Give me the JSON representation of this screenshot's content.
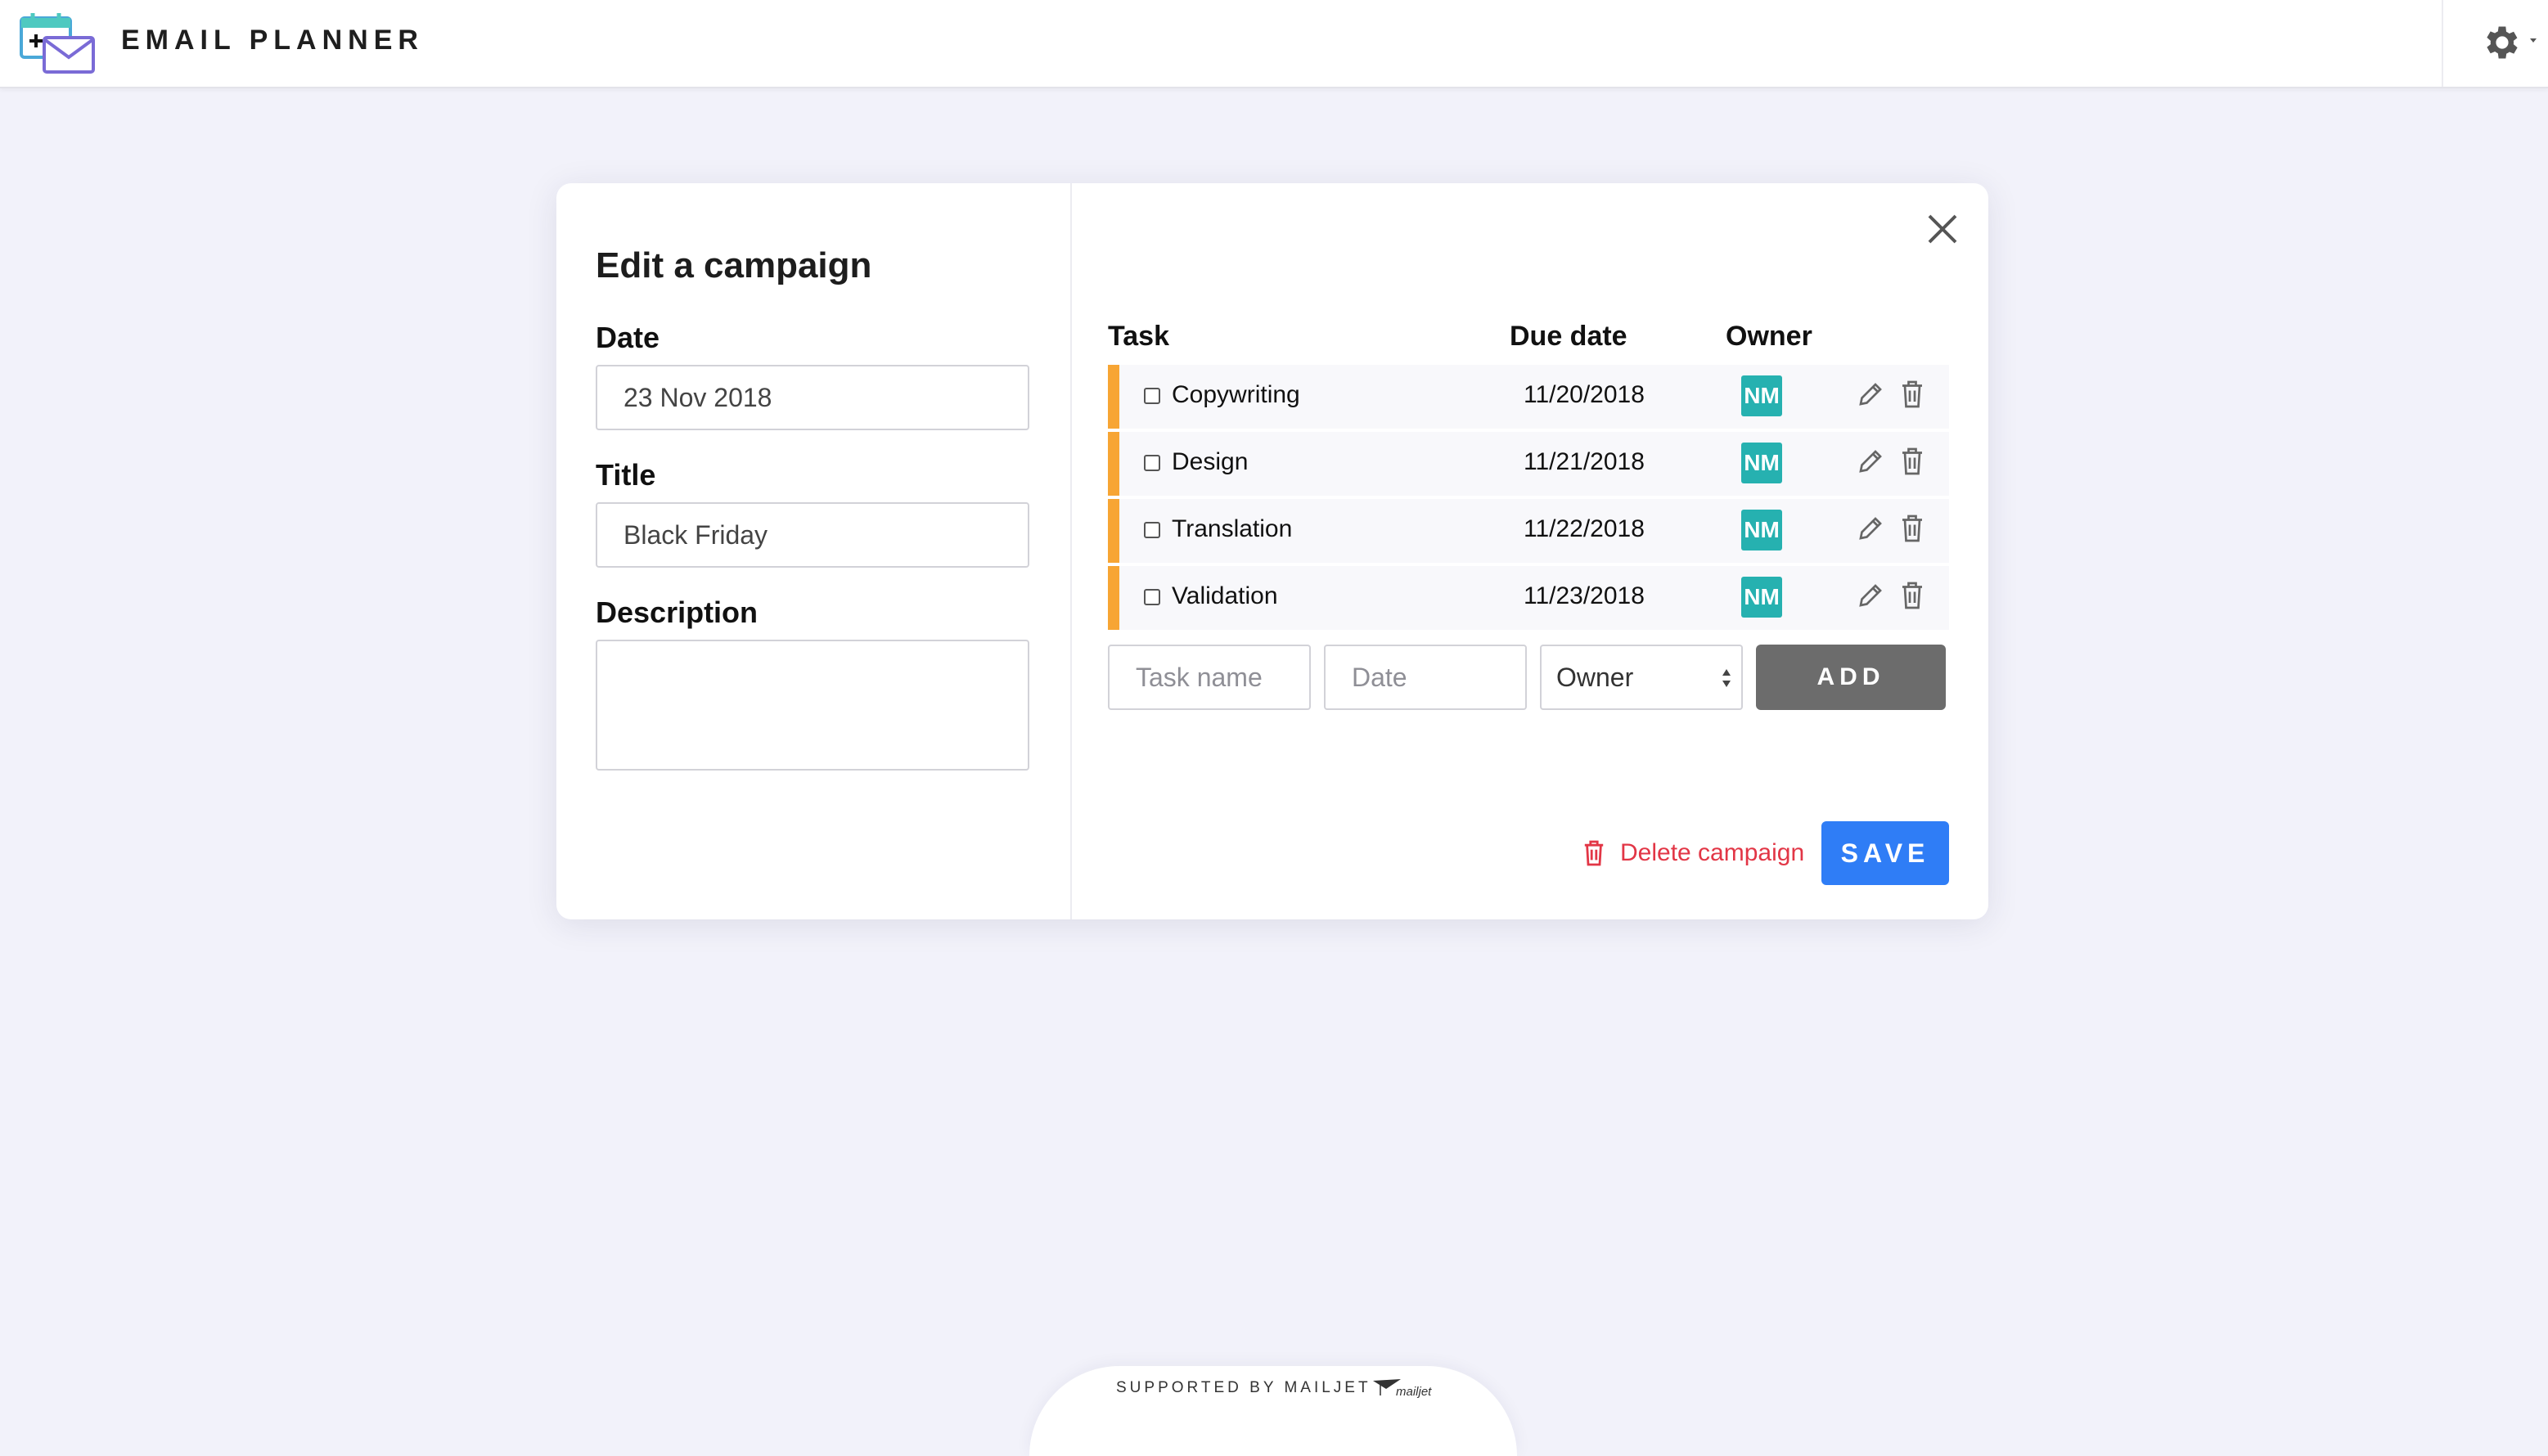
{
  "app": {
    "title": "EMAIL PLANNER"
  },
  "modal": {
    "title": "Edit a campaign",
    "date_label": "Date",
    "date_value": "23 Nov 2018",
    "title_label": "Title",
    "title_value": "Black Friday",
    "description_label": "Description",
    "description_value": ""
  },
  "tasks": {
    "columns": {
      "task": "Task",
      "due_date": "Due date",
      "owner": "Owner"
    },
    "rows": [
      {
        "name": "Copywriting",
        "due": "11/20/2018",
        "owner": "NM"
      },
      {
        "name": "Design",
        "due": "11/21/2018",
        "owner": "NM"
      },
      {
        "name": "Translation",
        "due": "11/22/2018",
        "owner": "NM"
      },
      {
        "name": "Validation",
        "due": "11/23/2018",
        "owner": "NM"
      }
    ],
    "new_task": {
      "name_placeholder": "Task name",
      "date_placeholder": "Date",
      "owner_selected": "Owner",
      "add_label": "ADD"
    }
  },
  "actions": {
    "delete_label": "Delete campaign",
    "save_label": "SAVE"
  },
  "footer": {
    "supported_by": "SUPPORTED BY MAILJET |",
    "mailjet_logo_text": "mailjet"
  },
  "colors": {
    "accent_blue": "#2f7df6",
    "task_stripe": "#f7a534",
    "owner_badge": "#26b1b0",
    "delete_red": "#e23646",
    "add_button": "#6c6c6c"
  },
  "icons": {
    "logo": "calendar-mail-icon",
    "settings": "gear-icon",
    "close": "close-icon",
    "edit": "pencil-icon",
    "delete": "trash-icon"
  }
}
